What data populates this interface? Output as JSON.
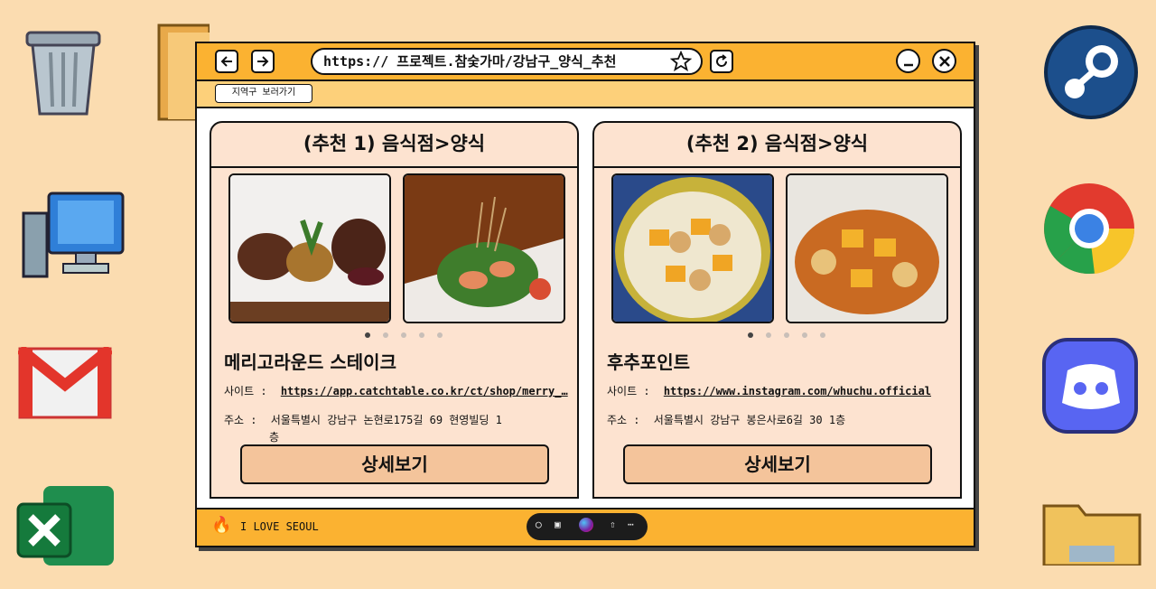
{
  "browser": {
    "url": "https:// 프로젝트.참숯가마/강남구_양식_추천",
    "region_button": "지역구 보러가기"
  },
  "cards": [
    {
      "heading": "(추천 1) 음식점>양식",
      "name": "메리고라운드 스테이크",
      "site_label": "사이트 :",
      "site_url": "https://app.catchtable.co.kr/ct/shop/merry_…",
      "address_label": "주소 :",
      "address_line1": "서울특별시 강남구 논현로175길 69 현영빌딩 1",
      "address_line2": "층",
      "detail_button": "상세보기"
    },
    {
      "heading": "(추천 2) 음식점>양식",
      "name": "후추포인트",
      "site_label": "사이트 :",
      "site_url": "https://www.instagram.com/whuchu.official",
      "address_label": "주소 :",
      "address_line1": "서울특별시 강남구 봉은사로6길 30 1층",
      "address_line2": "",
      "detail_button": "상세보기"
    }
  ],
  "footer": {
    "text": "I LOVE SEOUL",
    "fire_icon": "🔥"
  },
  "taskbar_pill": [
    "chat-icon",
    "inbox-icon",
    "orb-icon",
    "share-icon",
    "more-icon"
  ],
  "colors": {
    "desktop": "#fbdcb0",
    "window_bar": "#fbb231",
    "card_bg": "#fde3d0",
    "button_bg": "#f4c49b"
  }
}
